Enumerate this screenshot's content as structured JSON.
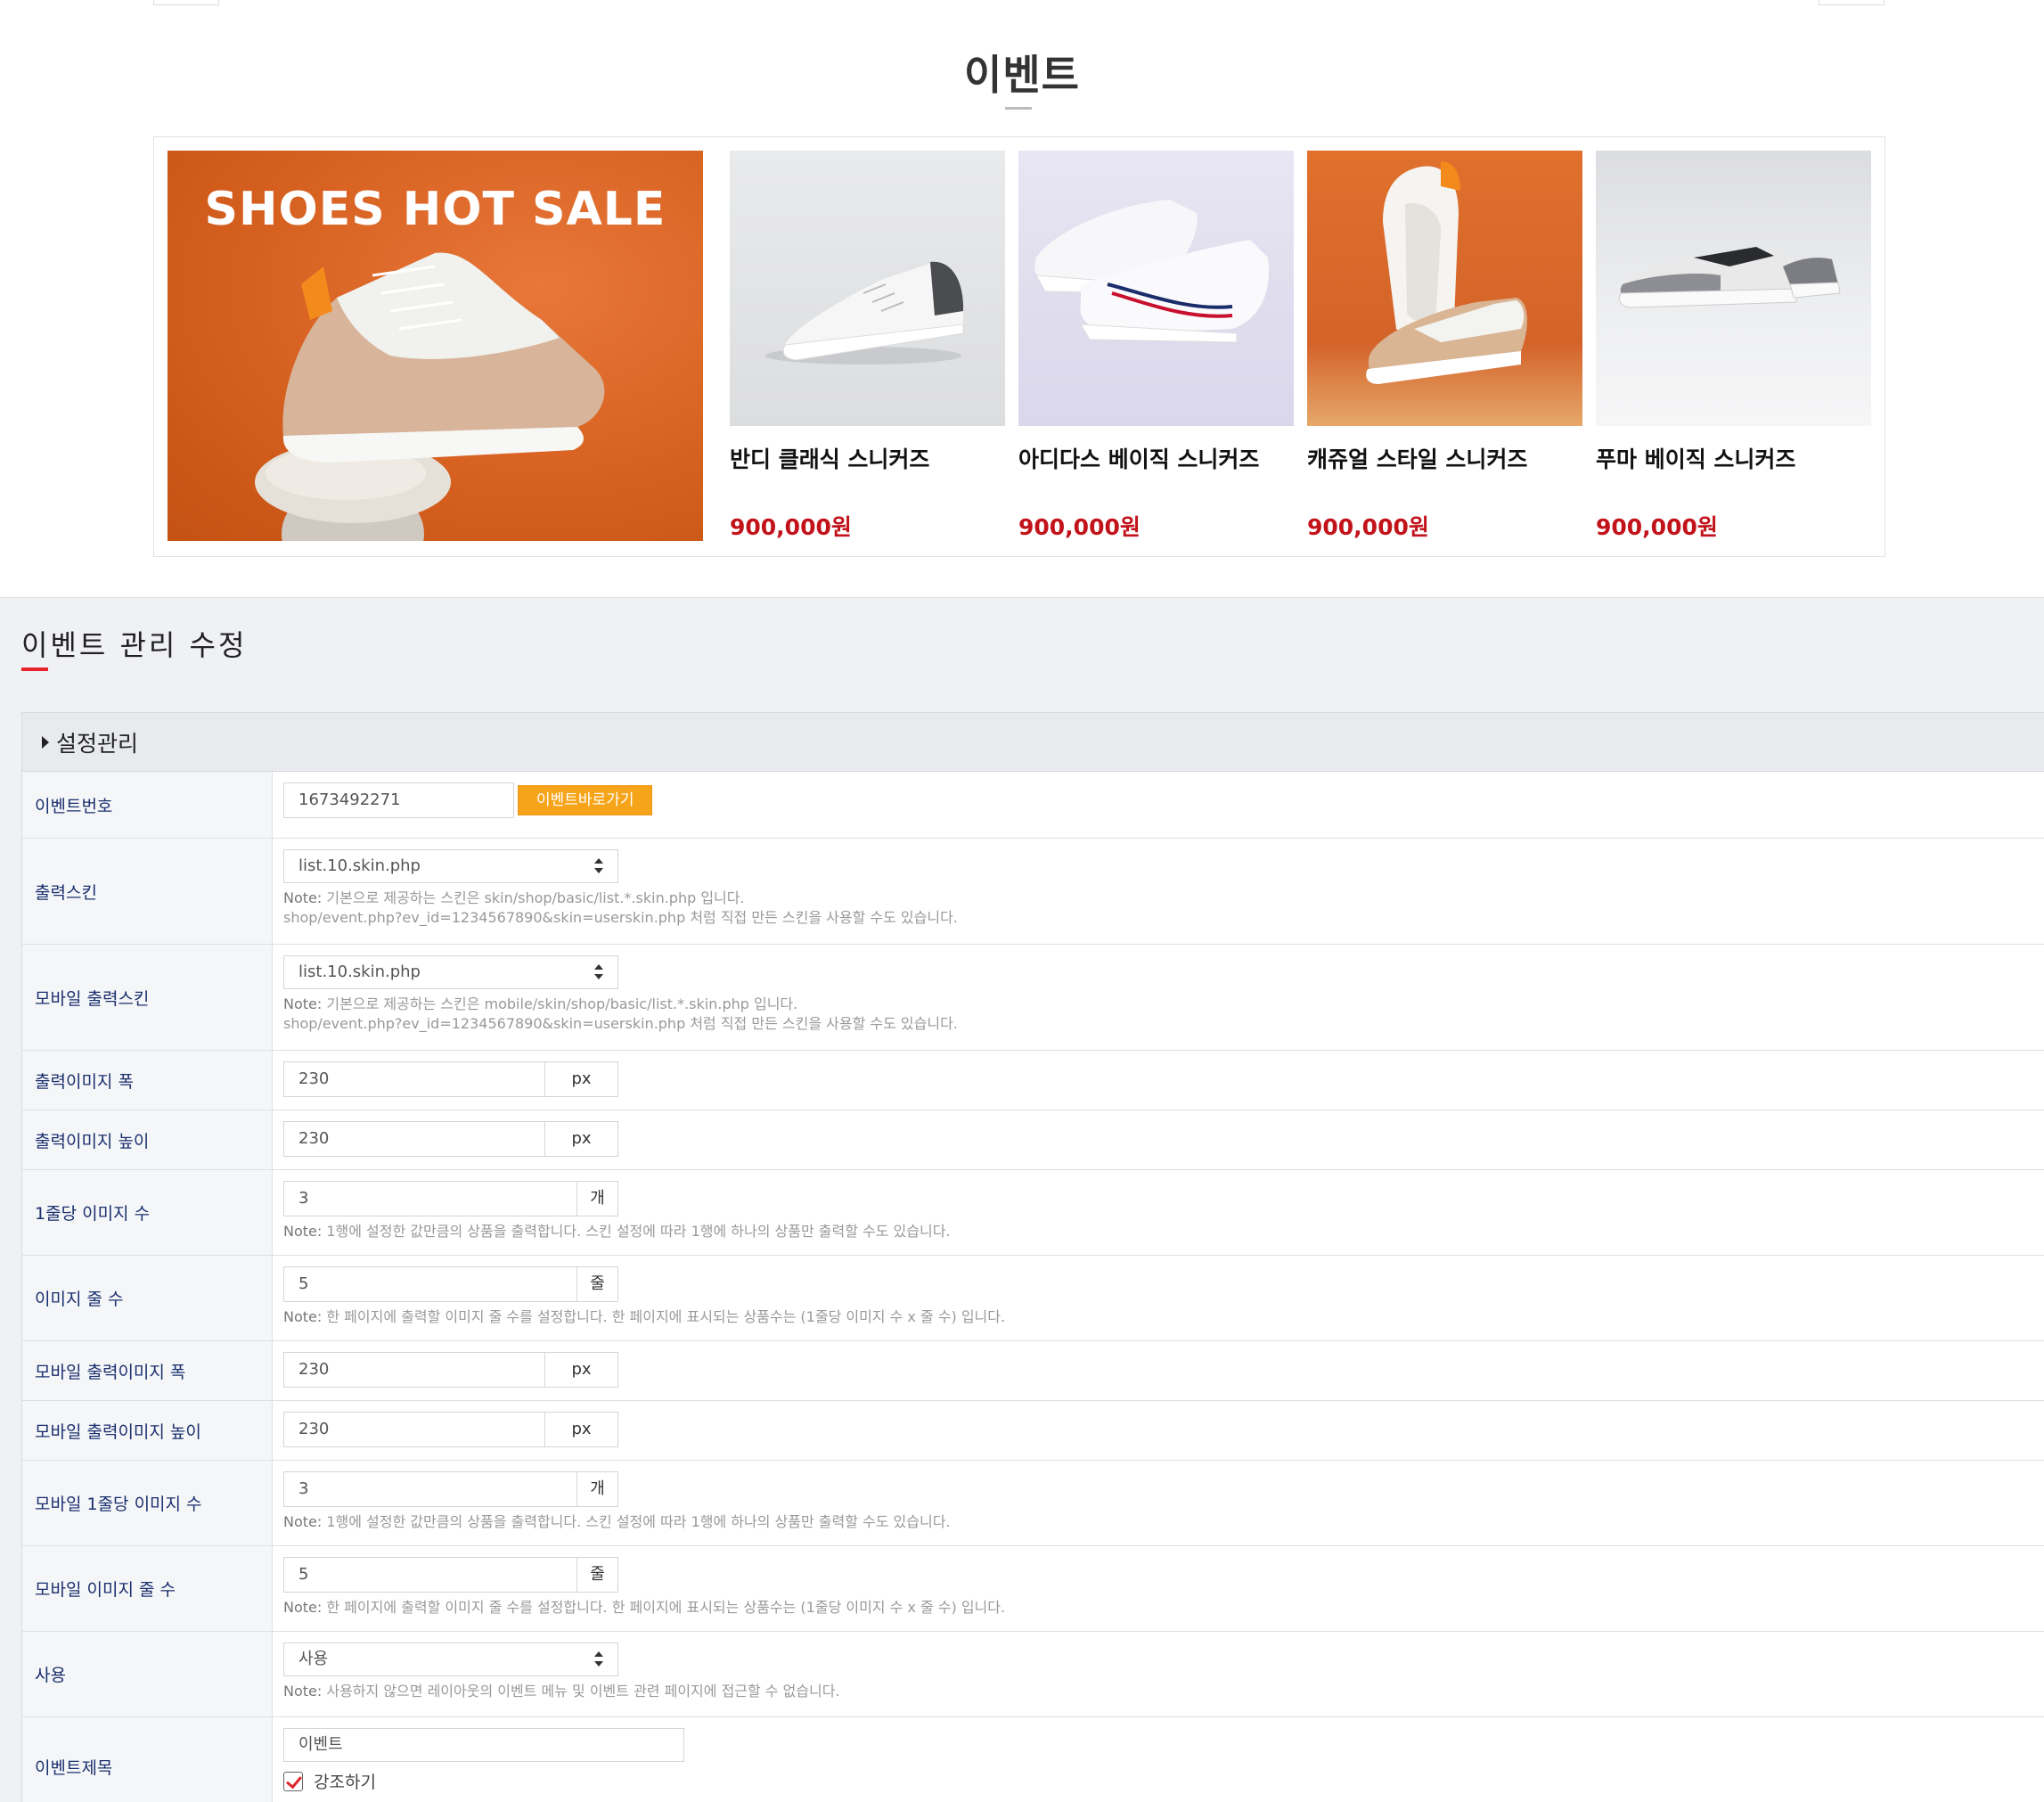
{
  "preview": {
    "title": "이벤트",
    "banner_text": "SHOES HOT SALE",
    "products": [
      {
        "name": "반디 클래식 스니커즈",
        "price": "900,000원"
      },
      {
        "name": "아디다스 베이직 스니커즈",
        "price": "900,000원"
      },
      {
        "name": "캐쥬얼 스타일 스니커즈",
        "price": "900,000원"
      },
      {
        "name": "푸마 베이직 스니커즈",
        "price": "900,000원"
      }
    ]
  },
  "admin": {
    "page_title": "이벤트 관리 수정",
    "section_title": "설정관리",
    "fields": {
      "event_no": {
        "label": "이벤트번호",
        "value": "1673492271",
        "button": "이벤트바로가기"
      },
      "skin": {
        "label": "출력스킨",
        "value": "list.10.skin.php",
        "note_prefix": "Note:",
        "note_line1": " 기본으로 제공하는 스킨은 skin/shop/basic/list.*.skin.php 입니다.",
        "note_line2": "shop/event.php?ev_id=1234567890&skin=userskin.php 처럼 직접 만든 스킨을 사용할 수도 있습니다."
      },
      "mobile_skin": {
        "label": "모바일 출력스킨",
        "value": "list.10.skin.php",
        "note_prefix": "Note:",
        "note_line1": " 기본으로 제공하는 스킨은 mobile/skin/shop/basic/list.*.skin.php 입니다.",
        "note_line2": "shop/event.php?ev_id=1234567890&skin=userskin.php 처럼 직접 만든 스킨을 사용할 수도 있습니다."
      },
      "img_width": {
        "label": "출력이미지 폭",
        "value": "230",
        "unit": "px"
      },
      "img_height": {
        "label": "출력이미지 높이",
        "value": "230",
        "unit": "px"
      },
      "per_row": {
        "label": "1줄당 이미지 수",
        "value": "3",
        "unit": "개",
        "note_prefix": "Note:",
        "note": " 1행에 설정한 값만큼의 상품을 출력합니다. 스킨 설정에 따라 1행에 하나의 상품만 출력할 수도 있습니다."
      },
      "rows": {
        "label": "이미지 줄 수",
        "value": "5",
        "unit": "줄",
        "note_prefix": "Note:",
        "note": " 한 페이지에 출력할 이미지 줄 수를 설정합니다. 한 페이지에 표시되는 상품수는 (1줄당 이미지 수 x 줄 수) 입니다."
      },
      "m_img_width": {
        "label": "모바일 출력이미지 폭",
        "value": "230",
        "unit": "px"
      },
      "m_img_height": {
        "label": "모바일 출력이미지 높이",
        "value": "230",
        "unit": "px"
      },
      "m_per_row": {
        "label": "모바일 1줄당 이미지 수",
        "value": "3",
        "unit": "개",
        "note_prefix": "Note:",
        "note": " 1행에 설정한 값만큼의 상품을 출력합니다. 스킨 설정에 따라 1행에 하나의 상품만 출력할 수도 있습니다."
      },
      "m_rows": {
        "label": "모바일 이미지 줄 수",
        "value": "5",
        "unit": "줄",
        "note_prefix": "Note:",
        "note": " 한 페이지에 출력할 이미지 줄 수를 설정합니다. 한 페이지에 표시되는 상품수는 (1줄당 이미지 수 x 줄 수) 입니다."
      },
      "use": {
        "label": "사용",
        "value": "사용",
        "note_prefix": "Note:",
        "note": " 사용하지 않으면 레이아웃의 이벤트 메뉴 및 이벤트 관련 페이지에 접근할 수 없습니다."
      },
      "event_title": {
        "label": "이벤트제목",
        "value": "이벤트",
        "checkbox_label": "강조하기",
        "checked": true
      }
    }
  },
  "colors": {
    "accent_red": "#e8232a",
    "price_red": "#c2121a",
    "button_orange": "#f6a419",
    "label_navy": "#1a2f6e"
  }
}
